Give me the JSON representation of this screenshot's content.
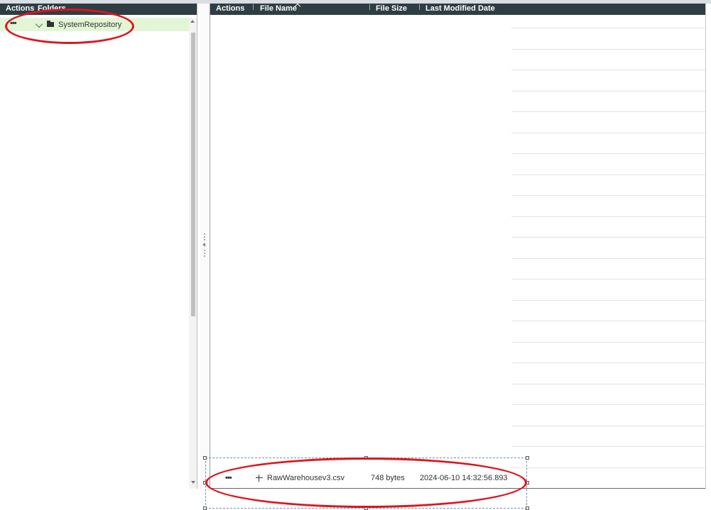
{
  "folders_panel": {
    "header": {
      "actions": "Actions",
      "folders": "Folders"
    },
    "tree": [
      {
        "actions": "•••",
        "label": "SystemRepository",
        "expanded": true,
        "selected": true
      }
    ]
  },
  "files_panel": {
    "columns": {
      "actions": "Actions",
      "file_name": "File Name",
      "file_size": "File Size",
      "last_modified": "Last Modified Date"
    },
    "sort": {
      "column": "File Name",
      "direction": "ascending"
    },
    "rows": [
      {
        "actions": "•••",
        "name": "RawWarehousev3.csv",
        "size": "748 bytes",
        "modified": "2024-06-10 14:32:56.893"
      }
    ]
  },
  "colors": {
    "header_bg": "#2f3d44",
    "selected_row_bg": "#e2f6d6",
    "annotation": "#e0141e"
  },
  "icons": [
    "ellipsis-icon",
    "chevron-down-icon",
    "folder-icon",
    "sort-ascending-icon",
    "move-icon",
    "scroll-up-icon",
    "scroll-down-icon",
    "splitter-arrow-icon"
  ]
}
